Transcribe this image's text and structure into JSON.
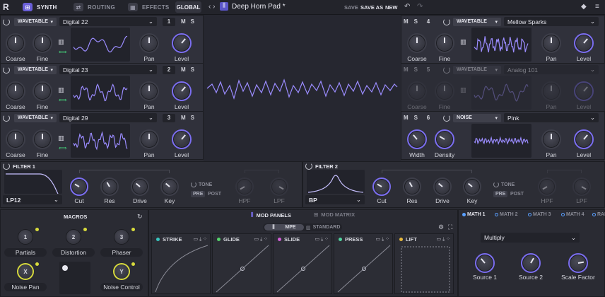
{
  "topbar": {
    "logo": "R",
    "tabs": [
      {
        "label": "SYNTH",
        "icon": "synth-icon"
      },
      {
        "label": "ROUTING",
        "icon": "routing-icon"
      },
      {
        "label": "EFFECTS",
        "icon": "effects-icon"
      }
    ],
    "global": "GLOBAL",
    "preset_name": "Deep Horn Pad *",
    "save": "SAVE",
    "save_as": "SAVE AS",
    "new": "NEW"
  },
  "oscillators": [
    {
      "type": "WAVETABLE",
      "wavetable": "Digital 22",
      "number": "1",
      "m": "M",
      "s": "S",
      "coarse": "Coarse",
      "fine": "Fine",
      "pan": "Pan",
      "level": "Level"
    },
    {
      "type": "WAVETABLE",
      "wavetable": "Digital 23",
      "number": "2",
      "m": "M",
      "s": "S",
      "coarse": "Coarse",
      "fine": "Fine",
      "pan": "Pan",
      "level": "Level"
    },
    {
      "type": "WAVETABLE",
      "wavetable": "Digital 29",
      "number": "3",
      "m": "M",
      "s": "S",
      "coarse": "Coarse",
      "fine": "Fine",
      "pan": "Pan",
      "level": "Level"
    },
    {
      "type": "WAVETABLE",
      "wavetable": "Mellow Sparks",
      "number": "4",
      "m": "M",
      "s": "S",
      "coarse": "Coarse",
      "fine": "Fine",
      "pan": "Pan",
      "level": "Level"
    },
    {
      "type": "WAVETABLE",
      "wavetable": "Analog 101",
      "number": "5",
      "m": "M",
      "s": "S",
      "coarse": "Coarse",
      "fine": "Fine",
      "pan": "Pan",
      "level": "Level"
    },
    {
      "type": "NOISE",
      "wavetable": "Pink",
      "number": "6",
      "m": "M",
      "s": "S",
      "coarse": "Width",
      "fine": "Density",
      "pan": "Pan",
      "level": "Level"
    }
  ],
  "filters": [
    {
      "title": "FILTER 1",
      "type": "LP12",
      "cut": "Cut",
      "res": "Res",
      "drive": "Drive",
      "key": "Key",
      "tone": "TONE",
      "pre": "PRE",
      "post": "POST",
      "hpf": "HPF",
      "lpf": "LPF"
    },
    {
      "title": "FILTER 2",
      "type": "BP",
      "cut": "Cut",
      "res": "Res",
      "drive": "Drive",
      "key": "Key",
      "tone": "TONE",
      "pre": "PRE",
      "post": "POST",
      "hpf": "HPF",
      "lpf": "LPF"
    }
  ],
  "macros": {
    "title": "MACROS",
    "items": [
      {
        "num": "1",
        "label": "Partials"
      },
      {
        "num": "2",
        "label": "Distortion"
      },
      {
        "num": "3",
        "label": "Phaser"
      },
      {
        "num": "X",
        "label": "Noise Pan"
      },
      {
        "num": "Y",
        "label": "Noise Control"
      }
    ]
  },
  "mod": {
    "tab_panels": "MOD PANELS",
    "tab_matrix": "MOD MATRIX",
    "mpe": "MPE",
    "standard": "STANDARD",
    "columns": [
      {
        "label": "STRIKE",
        "color": "#39c6c0"
      },
      {
        "label": "GLIDE",
        "color": "#55d36b"
      },
      {
        "label": "SLIDE",
        "color": "#d35fd8"
      },
      {
        "label": "PRESS",
        "color": "#52d4a0"
      },
      {
        "label": "LIFT",
        "color": "#e6b93c"
      }
    ]
  },
  "math": {
    "tabs": [
      "MATH 1",
      "MATH 2",
      "MATH 3",
      "MATH 4",
      "RANDOM"
    ],
    "mode": "Multiply",
    "source1": "Source 1",
    "source2": "Source 2",
    "scale": "Scale Factor"
  },
  "colors": {
    "accent": "#7b6ef0",
    "wave": "#9b8cff"
  }
}
